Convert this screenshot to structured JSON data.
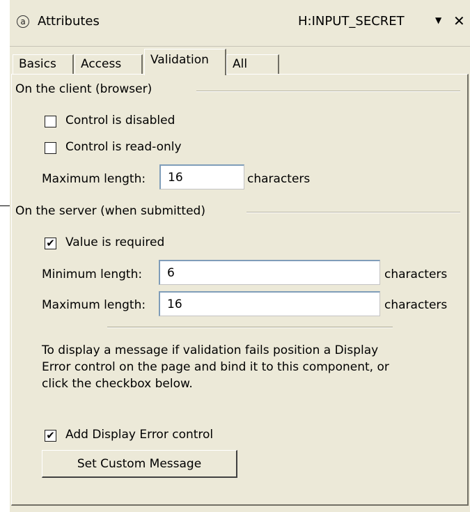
{
  "header": {
    "icon_glyph": "a",
    "icon_name": "attributes-icon",
    "title": "Attributes",
    "component": "H:INPUT_SECRET",
    "menu_glyph": "▼",
    "close_glyph": "✕"
  },
  "tabs": [
    {
      "label": "Basics",
      "active": false
    },
    {
      "label": "Access",
      "active": false
    },
    {
      "label": "Validation",
      "active": true
    },
    {
      "label": "All",
      "active": false
    }
  ],
  "client": {
    "group_label": "On the client (browser)",
    "disabled": {
      "label": "Control is disabled",
      "checked": false,
      "glyph": ""
    },
    "readonly": {
      "label": "Control is read-only",
      "checked": false,
      "glyph": ""
    },
    "maxlength": {
      "label": "Maximum length:",
      "value": "16",
      "unit": "characters"
    }
  },
  "server": {
    "group_label": "On the server (when submitted)",
    "required": {
      "label": "Value is required",
      "checked": true,
      "glyph": "✔"
    },
    "minlength": {
      "label": "Minimum length:",
      "value": "6",
      "unit": "characters"
    },
    "maxlength": {
      "label": "Maximum length:",
      "value": "16",
      "unit": "characters"
    }
  },
  "message": {
    "line1": "To display a message if validation fails position a Display",
    "line2": "Error control on the page and bind it to this component, or",
    "line3": "click the checkbox below."
  },
  "display_error": {
    "label": "Add Display Error control",
    "checked": true,
    "glyph": "✔"
  },
  "custom_message_button": "Set Custom Message",
  "colors": {
    "panel_bg": "#ece9d8",
    "input_border": "#7f9db9",
    "group_line": "#b8b4a5"
  }
}
